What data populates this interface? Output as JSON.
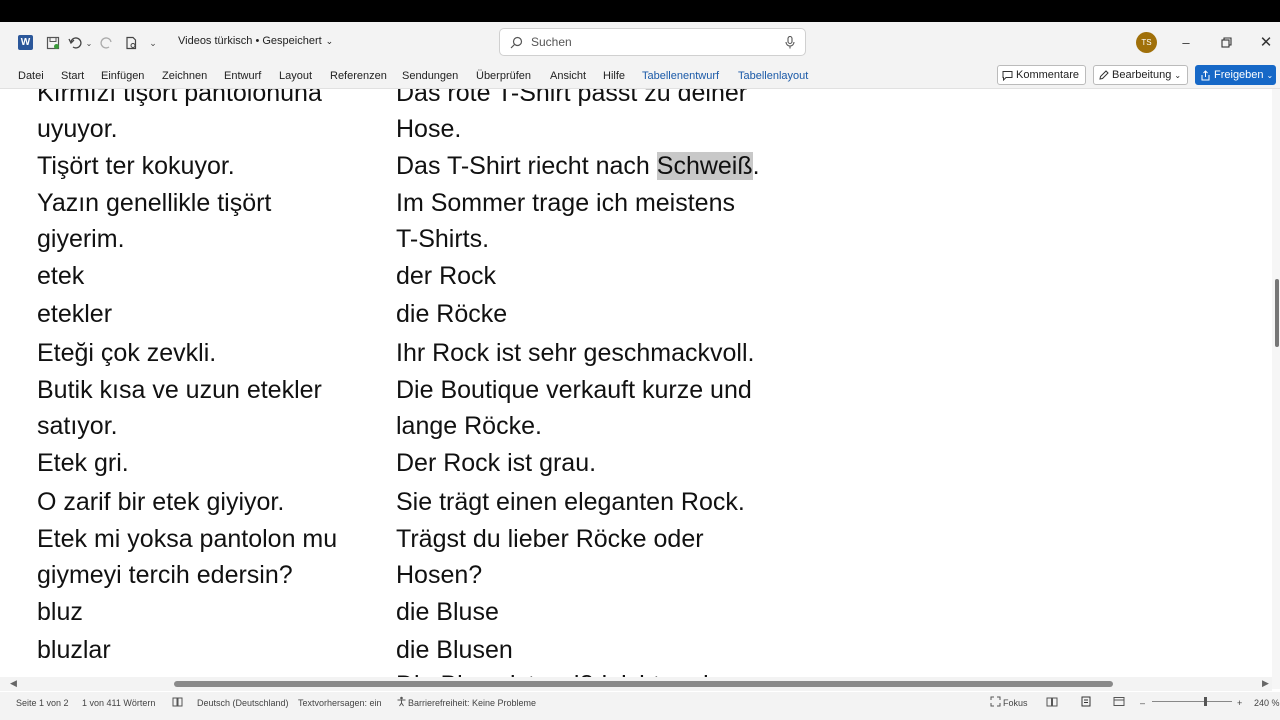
{
  "titlebar": {
    "app_logo": "W",
    "doc_title": "Videos türkisch • Gespeichert",
    "search_placeholder": "Suchen",
    "avatar_initials": "TS",
    "icons": [
      "save-icon",
      "undo-icon",
      "redo-icon",
      "print-preview-icon",
      "customize-icon",
      "search-icon",
      "mic-icon",
      "minimize-icon",
      "restore-icon",
      "close-icon"
    ]
  },
  "ribbon": {
    "tabs": [
      "Datei",
      "Start",
      "Einfügen",
      "Zeichnen",
      "Entwurf",
      "Layout",
      "Referenzen",
      "Sendungen",
      "Überprüfen",
      "Ansicht",
      "Hilfe"
    ],
    "context_tabs": [
      "Tabellenentwurf",
      "Tabellenlayout"
    ],
    "comments_label": "Kommentare",
    "editing_label": "Bearbeitung",
    "share_label": "Freigeben"
  },
  "document": {
    "left_lines": [
      "Kırmızı tişört pantolonuna",
      "uyuyor.",
      "Tişört ter kokuyor.",
      "Yazın genellikle tişört",
      "giyerim.",
      "etek",
      "etekler",
      "Eteği çok zevkli.",
      "Butik kısa ve uzun etekler",
      "satıyor.",
      "Etek gri.",
      "O zarif bir etek giyiyor.",
      "Etek mi yoksa pantolon mu",
      "giymeyi tercih edersin?",
      "bluz",
      "bluzlar"
    ],
    "right_lines": [
      "Das rote T-Shirt passt zu deiner",
      "Hose.",
      "Das T-Shirt riecht nach ",
      "Im Sommer trage ich meistens",
      "T-Shirts.",
      "der Rock",
      "die Röcke",
      "Ihr Rock ist sehr geschmackvoll.",
      "Die Boutique verkauft kurze und",
      "lange Röcke.",
      "Der Rock ist grau.",
      "Sie trägt einen eleganten Rock.",
      "Trägst du lieber Röcke oder",
      "Hosen?",
      "die Bluse",
      "die Blusen",
      "Die Bluse ist weiß leicht und"
    ],
    "highlighted_word": "Schweiß",
    "after_highlight": "."
  },
  "statusbar": {
    "page": "Seite 1 von 2",
    "words": "1 von 411 Wörtern",
    "language": "Deutsch (Deutschland)",
    "predictions": "Textvorhersagen: ein",
    "accessibility": "Barrierefreiheit: Keine Probleme",
    "focus": "Fokus",
    "zoom": "240 %"
  }
}
